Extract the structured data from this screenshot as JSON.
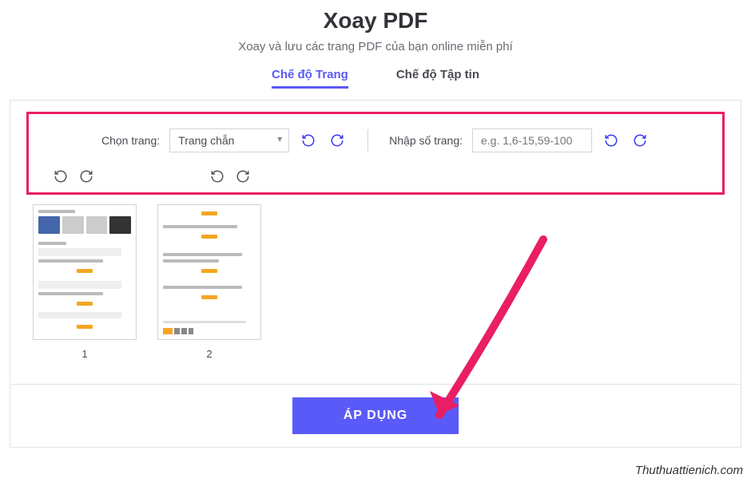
{
  "header": {
    "title": "Xoay PDF",
    "subtitle": "Xoay và lưu các trang PDF của bạn online miễn phí"
  },
  "tabs": {
    "page_mode": "Chế độ Trang",
    "file_mode": "Chế độ Tập tin"
  },
  "controls": {
    "select_page_label": "Chọn trang:",
    "select_value": "Trang chẵn",
    "enter_page_label": "Nhập số trang:",
    "input_placeholder": "e.g. 1,6-15,59-100"
  },
  "thumbnails": [
    {
      "label": "1"
    },
    {
      "label": "2"
    }
  ],
  "footer": {
    "apply_label": "ÁP DỤNG"
  },
  "watermark": "Thuthuattienich.com"
}
